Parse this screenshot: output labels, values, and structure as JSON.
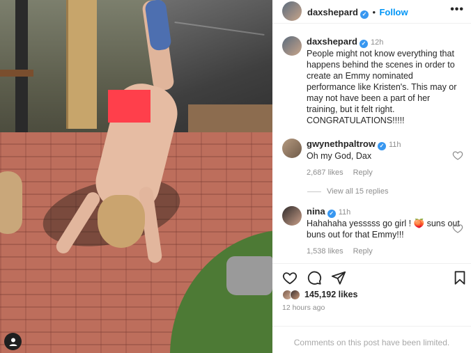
{
  "post": {
    "owner": "daxshepard",
    "follow_label": "Follow",
    "separator": "•",
    "more_label": "•••"
  },
  "caption": {
    "username": "daxshepard",
    "time": "12h",
    "text": "People might not know everything that happens behind the scenes in order to create an Emmy nominated performance like Kristen's. This may or may not have been a part of her training, but it felt right. CONGRATULATIONS!!!!!"
  },
  "comments": [
    {
      "username": "gwynethpaltrow",
      "time": "11h",
      "text": "Oh my God, Dax",
      "likes": "2,687 likes",
      "reply_label": "Reply"
    },
    {
      "username": "nina",
      "time": "11h",
      "text": "Hahahaha yesssss go girl ! 🍑 suns out buns out for that Emmy!!!",
      "likes": "1,538 likes",
      "reply_label": "Reply"
    }
  ],
  "view_replies": "View all 15 replies",
  "likes": "145,192 likes",
  "posted": "12 hours ago",
  "limited_notice": "Comments on this post have been limited.",
  "colors": {
    "verified": "#3897f0",
    "follow": "#0095f6",
    "censor": "#ff3f4b"
  },
  "icons": [
    "verified-badge-icon",
    "more-options-icon",
    "heart-icon",
    "comment-icon",
    "share-icon",
    "bookmark-icon",
    "user-tag-icon"
  ]
}
